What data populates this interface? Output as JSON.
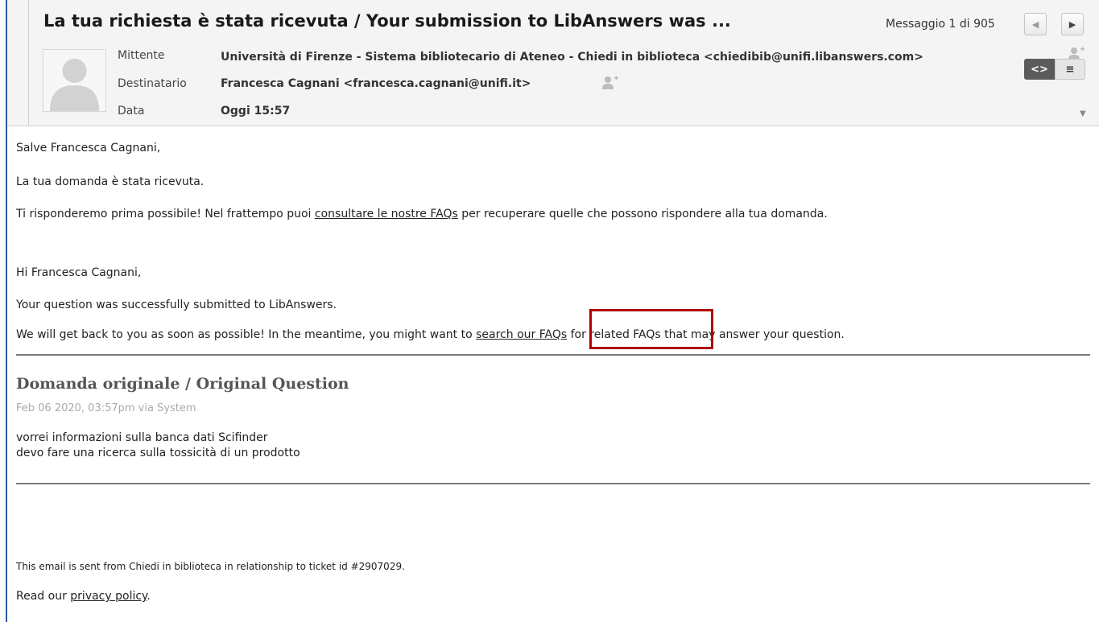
{
  "header": {
    "subject": "La tua richiesta è stata ricevuta / Your submission to LibAnswers was ...",
    "message_counter": "Messaggio 1 di 905",
    "prev_icon": "chevron-left-icon",
    "next_icon": "chevron-right-icon",
    "labels": {
      "from": "Mittente",
      "to": "Destinatario",
      "date": "Data"
    },
    "from_value": "Università di Firenze - Sistema bibliotecario di Ateneo - Chiedi in biblioteca <chiedibib@unifi.libanswers.com>",
    "to_value": "Francesca Cagnani <francesca.cagnani@unifi.it>",
    "date_value": "Oggi 15:57",
    "view_source_label": "<>",
    "view_plain_label": "≡"
  },
  "body": {
    "greeting_it": "Salve Francesca Cagnani,",
    "received_it": "La tua domanda è stata ricevuta.",
    "reply_it_before": "Ti risponderemo prima possibile! Nel frattempo puoi ",
    "reply_it_link": "consultare le nostre FAQs",
    "reply_it_after": " per recuperare quelle che possono rispondere alla tua domanda.",
    "greeting_en": "Hi Francesca Cagnani,",
    "received_en": "Your question was successfully submitted to LibAnswers.",
    "reply_en_before": "We will get back to you as soon as possible! In the meantime, you might want to ",
    "reply_en_link": "search our FAQs",
    "reply_en_after": " for related FAQs that may answer your question."
  },
  "original": {
    "title": "Domanda originale / Original Question",
    "meta": "Feb 06 2020, 03:57pm via System",
    "line1": "vorrei informazioni sulla banca dati Scifinder",
    "line2": "devo fare una ricerca sulla tossicità di un prodotto"
  },
  "footer": {
    "ticket_note": "This email is sent from Chiedi in biblioteca in relationship to ticket id #2907029.",
    "privacy_before": "Read our ",
    "privacy_link": "privacy policy",
    "privacy_after": "."
  },
  "colors": {
    "frame_border": "#2a5aa0",
    "highlight_box": "#b00000",
    "header_bg": "#f4f4f4"
  }
}
